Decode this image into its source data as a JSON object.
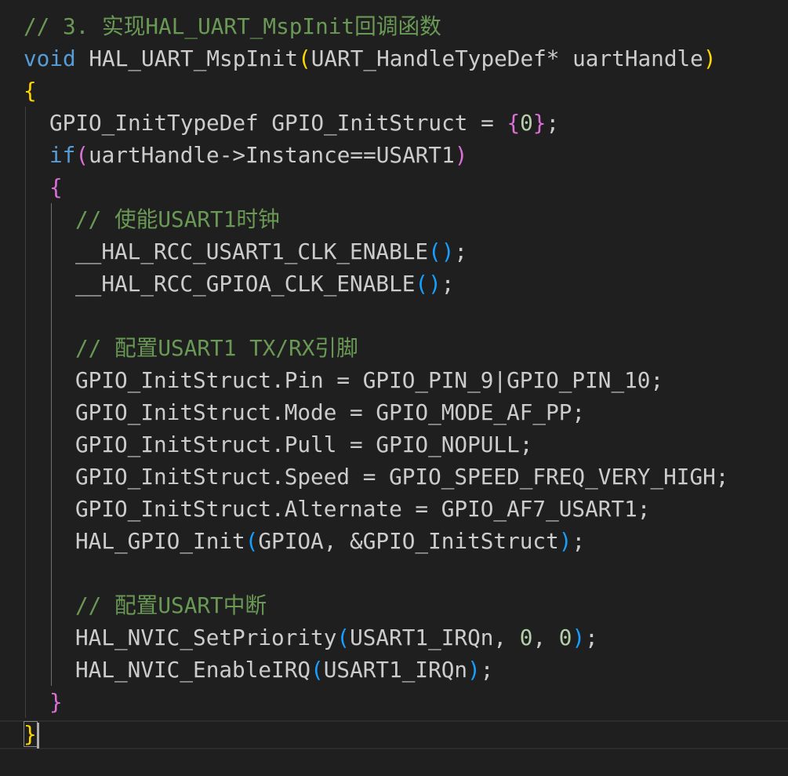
{
  "editor": {
    "theme_colors": {
      "background": "#1f1f1f",
      "comment": "#6a9955",
      "keyword": "#569cd6",
      "control": "#c586c0",
      "text": "#cccccc",
      "number": "#b5cea8",
      "bracket_gold": "#ffd700",
      "bracket_purple": "#da70d6",
      "bracket_blue": "#179fff"
    },
    "lines": [
      {
        "indent": 0,
        "tokens": [
          {
            "t": "// 3. 实现HAL_UART_MspInit回调函数",
            "c": "comment"
          }
        ]
      },
      {
        "indent": 0,
        "tokens": [
          {
            "t": "void",
            "c": "keyword"
          },
          {
            "t": " HAL_UART_MspInit",
            "c": "text"
          },
          {
            "t": "(",
            "c": "bracket_gold"
          },
          {
            "t": "UART_HandleTypeDef* uartHandle",
            "c": "text"
          },
          {
            "t": ")",
            "c": "bracket_gold"
          }
        ]
      },
      {
        "indent": 0,
        "tokens": [
          {
            "t": "{",
            "c": "bracket_gold"
          }
        ]
      },
      {
        "indent": 1,
        "tokens": [
          {
            "t": "GPIO_InitTypeDef GPIO_InitStruct = ",
            "c": "text"
          },
          {
            "t": "{",
            "c": "bracket_purple"
          },
          {
            "t": "0",
            "c": "number"
          },
          {
            "t": "}",
            "c": "bracket_purple"
          },
          {
            "t": ";",
            "c": "text"
          }
        ]
      },
      {
        "indent": 1,
        "tokens": [
          {
            "t": "if",
            "c": "keyword"
          },
          {
            "t": "(",
            "c": "bracket_purple"
          },
          {
            "t": "uartHandle->Instance==USART1",
            "c": "text"
          },
          {
            "t": ")",
            "c": "bracket_purple"
          }
        ]
      },
      {
        "indent": 1,
        "tokens": [
          {
            "t": "{",
            "c": "bracket_purple"
          }
        ]
      },
      {
        "indent": 2,
        "tokens": [
          {
            "t": "// 使能USART1时钟",
            "c": "comment"
          }
        ]
      },
      {
        "indent": 2,
        "tokens": [
          {
            "t": "__HAL_RCC_USART1_CLK_ENABLE",
            "c": "text"
          },
          {
            "t": "()",
            "c": "bracket_blue"
          },
          {
            "t": ";",
            "c": "text"
          }
        ]
      },
      {
        "indent": 2,
        "tokens": [
          {
            "t": "__HAL_RCC_GPIOA_CLK_ENABLE",
            "c": "text"
          },
          {
            "t": "()",
            "c": "bracket_blue"
          },
          {
            "t": ";",
            "c": "text"
          }
        ]
      },
      {
        "indent": 2,
        "tokens": []
      },
      {
        "indent": 2,
        "tokens": [
          {
            "t": "// 配置USART1 TX/RX引脚",
            "c": "comment"
          }
        ]
      },
      {
        "indent": 2,
        "tokens": [
          {
            "t": "GPIO_InitStruct.Pin = GPIO_PIN_9|GPIO_PIN_10;",
            "c": "text"
          }
        ]
      },
      {
        "indent": 2,
        "tokens": [
          {
            "t": "GPIO_InitStruct.Mode = GPIO_MODE_AF_PP;",
            "c": "text"
          }
        ]
      },
      {
        "indent": 2,
        "tokens": [
          {
            "t": "GPIO_InitStruct.Pull = GPIO_NOPULL;",
            "c": "text"
          }
        ]
      },
      {
        "indent": 2,
        "tokens": [
          {
            "t": "GPIO_InitStruct.Speed = GPIO_SPEED_FREQ_VERY_HIGH;",
            "c": "text"
          }
        ]
      },
      {
        "indent": 2,
        "tokens": [
          {
            "t": "GPIO_InitStruct.Alternate = GPIO_AF7_USART1;",
            "c": "text"
          }
        ]
      },
      {
        "indent": 2,
        "tokens": [
          {
            "t": "HAL_GPIO_Init",
            "c": "text"
          },
          {
            "t": "(",
            "c": "bracket_blue"
          },
          {
            "t": "GPIOA, &GPIO_InitStruct",
            "c": "text"
          },
          {
            "t": ")",
            "c": "bracket_blue"
          },
          {
            "t": ";",
            "c": "text"
          }
        ]
      },
      {
        "indent": 2,
        "tokens": []
      },
      {
        "indent": 2,
        "tokens": [
          {
            "t": "// 配置USART中断",
            "c": "comment"
          }
        ]
      },
      {
        "indent": 2,
        "tokens": [
          {
            "t": "HAL_NVIC_SetPriority",
            "c": "text"
          },
          {
            "t": "(",
            "c": "bracket_blue"
          },
          {
            "t": "USART1_IRQn, ",
            "c": "text"
          },
          {
            "t": "0",
            "c": "number"
          },
          {
            "t": ", ",
            "c": "text"
          },
          {
            "t": "0",
            "c": "number"
          },
          {
            "t": ")",
            "c": "bracket_blue"
          },
          {
            "t": ";",
            "c": "text"
          }
        ]
      },
      {
        "indent": 2,
        "tokens": [
          {
            "t": "HAL_NVIC_EnableIRQ",
            "c": "text"
          },
          {
            "t": "(",
            "c": "bracket_blue"
          },
          {
            "t": "USART1_IRQn",
            "c": "text"
          },
          {
            "t": ")",
            "c": "bracket_blue"
          },
          {
            "t": ";",
            "c": "text"
          }
        ]
      },
      {
        "indent": 1,
        "tokens": [
          {
            "t": "}",
            "c": "bracket_purple"
          }
        ]
      },
      {
        "indent": 0,
        "tokens": [
          {
            "t": "}",
            "c": "bracket_gold"
          }
        ],
        "matched_bracket": true
      }
    ]
  }
}
